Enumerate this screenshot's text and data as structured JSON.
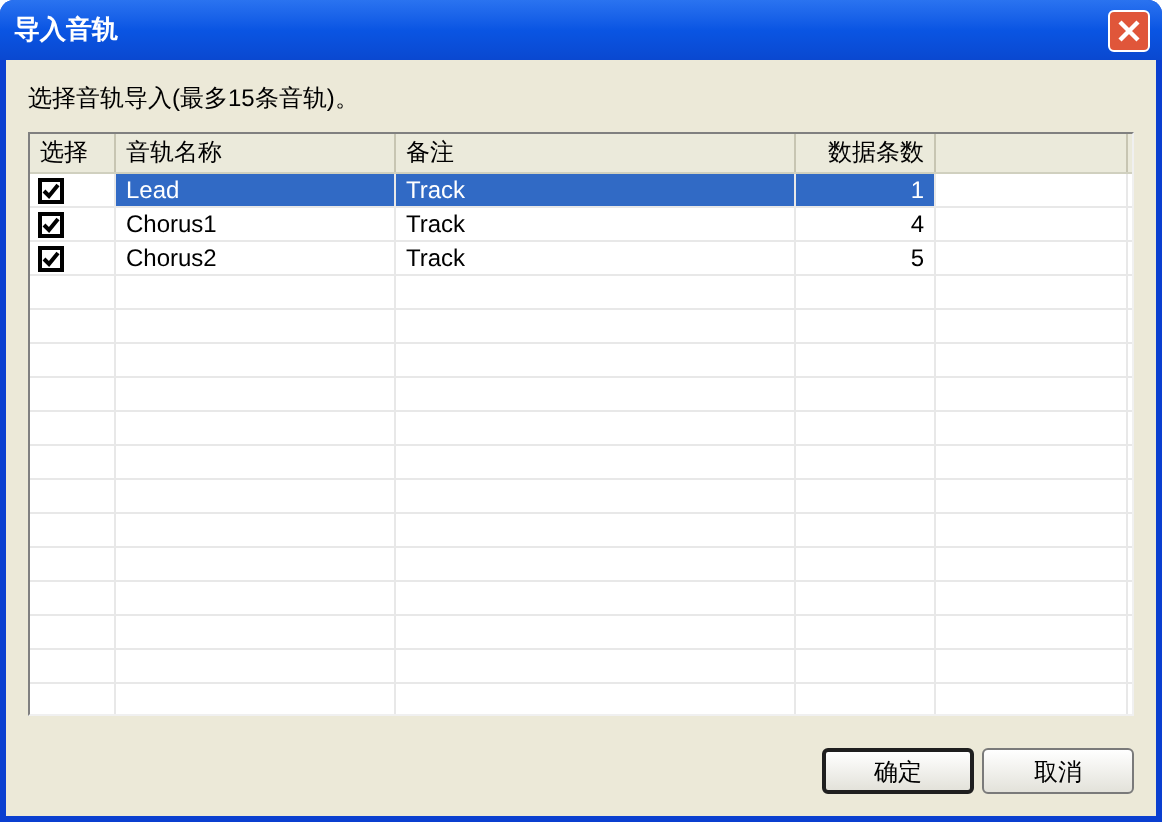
{
  "window": {
    "title": "导入音轨"
  },
  "instruction": "选择音轨导入(最多15条音轨)。",
  "table": {
    "columns": [
      "选择",
      "音轨名称",
      "备注",
      "数据条数"
    ],
    "rows": [
      {
        "checked": true,
        "selected": true,
        "name": "Lead",
        "note": "Track",
        "count": "1"
      },
      {
        "checked": true,
        "selected": false,
        "name": "Chorus1",
        "note": "Track",
        "count": "4"
      },
      {
        "checked": true,
        "selected": false,
        "name": "Chorus2",
        "note": "Track",
        "count": "5"
      }
    ]
  },
  "buttons": [
    {
      "label": "确定",
      "default": true
    },
    {
      "label": "取消",
      "default": false
    }
  ]
}
